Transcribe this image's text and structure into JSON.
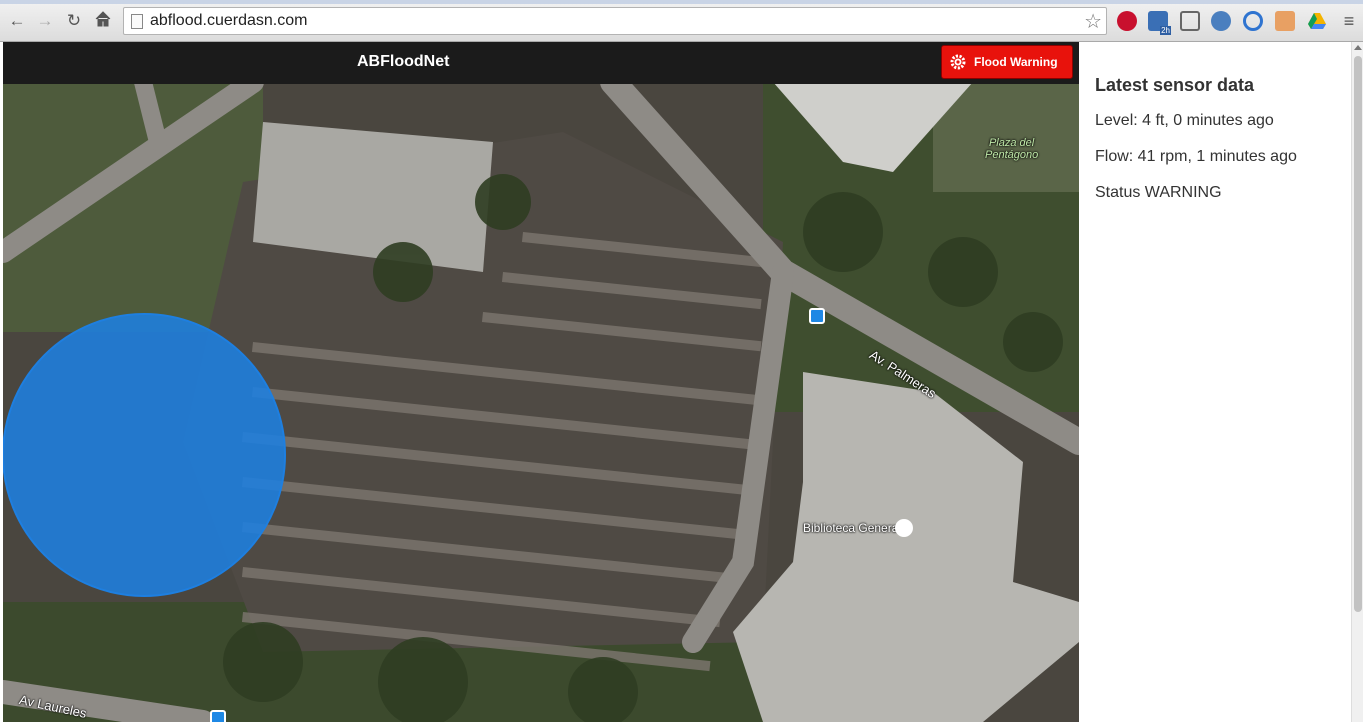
{
  "browser": {
    "url": "abflood.cuerdasn.com",
    "extension_badge": "2h"
  },
  "app": {
    "brand": "ABFloodNet",
    "warning_button_label": "Flood Warning"
  },
  "sidebar": {
    "heading": "Latest sensor data",
    "level": "Level: 4 ft, 0 minutes ago",
    "flow": "Flow: 41 rpm, 1 minutes ago",
    "status": "Status WARNING"
  },
  "map": {
    "labels": {
      "plaza_line1": "Plaza del",
      "plaza_line2": "Pentágono",
      "palmeras": "Av. Palmeras",
      "biblioteca": "Biblioteca General",
      "laureles": "Av Laureles"
    },
    "flood_circle_color": "#1e7fe0"
  },
  "colors": {
    "warning": "#e8120c",
    "navbar": "#1b1b1b"
  }
}
